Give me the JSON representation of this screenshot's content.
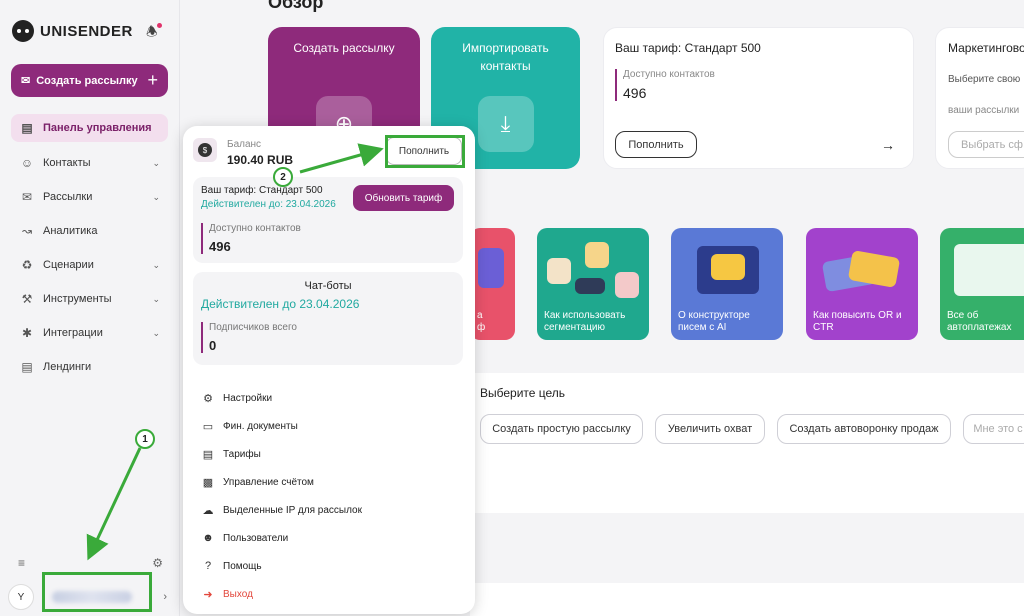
{
  "sidebar": {
    "logo": "UNISENDER",
    "create_label": "Создать рассылку",
    "items": [
      {
        "label": "Панель управления",
        "icon": "dashboard-icon"
      },
      {
        "label": "Контакты",
        "icon": "contacts-icon"
      },
      {
        "label": "Рассылки",
        "icon": "mail-icon"
      },
      {
        "label": "Аналитика",
        "icon": "chart-icon"
      },
      {
        "label": "Сценарии",
        "icon": "scenario-icon"
      },
      {
        "label": "Инструменты",
        "icon": "tools-icon"
      },
      {
        "label": "Интеграции",
        "icon": "integrations-icon"
      },
      {
        "label": "Лендинги",
        "icon": "landing-icon"
      }
    ],
    "avatar_letter": "Y"
  },
  "main": {
    "title": "Обзор",
    "tile_create": "Создать рассылку",
    "tile_import": "Импортировать контакты",
    "tariff": {
      "title": "Ваш тариф: Стандарт 500",
      "contacts_label": "Доступно контактов",
      "contacts_value": "496",
      "topup_label": "Пополнить"
    },
    "marketing": {
      "title": "Маркетингово",
      "desc1": "Выберите свою",
      "desc2": "ваши рассылки",
      "btn": "Выбрать сф"
    },
    "promos": [
      {
        "caption1": "а",
        "caption2": "ф"
      },
      {
        "caption1": "Как использовать",
        "caption2": "сегментацию"
      },
      {
        "caption1": "О конструкторе",
        "caption2": "писем с AI"
      },
      {
        "caption1": "Как повысить OR и",
        "caption2": "CTR"
      },
      {
        "caption1": "Все об",
        "caption2": "автоплатежах"
      }
    ],
    "goal": {
      "title": "Выберите цель",
      "buttons": [
        "Создать простую рассылку",
        "Увеличить охват",
        "Создать автоворонку продаж",
        "Мне это с"
      ]
    }
  },
  "popup": {
    "balance_label": "Баланс",
    "balance_value": "190.40 RUB",
    "topup": "Пополнить",
    "tariff_title": "Ваш тариф: Стандарт 500",
    "tariff_valid": "Действителен до: 23.04.2026",
    "update_btn": "Обновить тариф",
    "contacts_label": "Доступно контактов",
    "contacts_value": "496",
    "chat_title": "Чат-боты",
    "chat_valid": "Действителен до 23.04.2026",
    "subs_label": "Подписчиков всего",
    "subs_value": "0",
    "menu": [
      {
        "label": "Настройки",
        "icon": "gear-icon"
      },
      {
        "label": "Фин. документы",
        "icon": "document-icon"
      },
      {
        "label": "Тарифы",
        "icon": "tariff-icon"
      },
      {
        "label": "Управление счётом",
        "icon": "account-icon"
      },
      {
        "label": "Выделенные IP для рассылок",
        "icon": "cloud-icon"
      },
      {
        "label": "Пользователи",
        "icon": "users-icon"
      },
      {
        "label": "Помощь",
        "icon": "help-icon"
      },
      {
        "label": "Выход",
        "icon": "logout-icon"
      }
    ]
  },
  "annotations": {
    "badge1": "1",
    "badge2": "2",
    "color": "#3aaa3a"
  }
}
